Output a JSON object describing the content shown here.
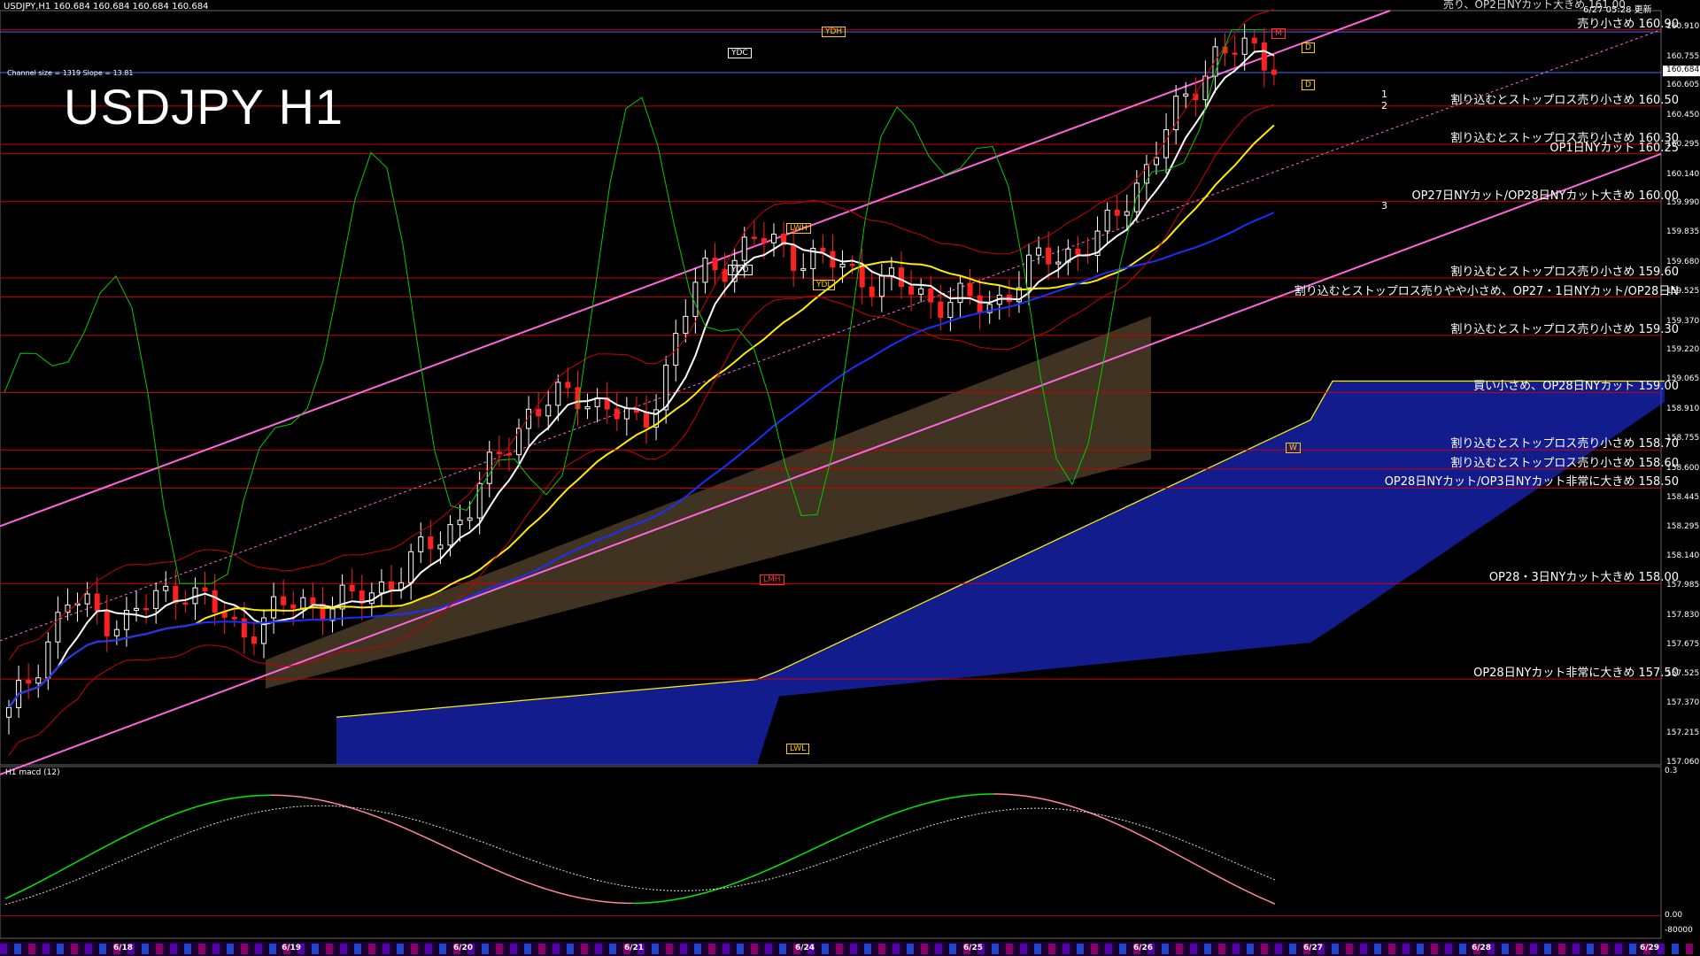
{
  "header": {
    "symbol_line": "USDJPY,H1  160.684 160.684 160.684 160.684",
    "channel_info": "Channel size = 1319 Slope = 13.81",
    "title": "USDJPY H1",
    "updated": "6/27 05:28 更新",
    "macd_label": "H1  macd (12)"
  },
  "colors": {
    "background": "#000000",
    "support_line": "#d00000",
    "bull_candle": "#ffffff",
    "bear_candle": "#ff2020",
    "channel": "#ff66dd",
    "ma_fast": "#ffffff",
    "ma_mid": "#ffee00",
    "ma_slow": "#1a2fff",
    "cloud_up": "#2233ff",
    "cloud_down": "#ffcc88",
    "macd_up": "#00ee00",
    "macd_down": "#ff8899",
    "adx": "#00cc00"
  },
  "chart_data": {
    "type": "candlestick",
    "symbol": "USDJPY",
    "timeframe": "H1",
    "ylim": [
      157.06,
      161.0
    ],
    "price_ticks": [
      "160.910",
      "160.755",
      "160.605",
      "160.450",
      "160.295",
      "160.140",
      "159.990",
      "159.835",
      "159.680",
      "159.525",
      "159.370",
      "159.220",
      "159.065",
      "158.910",
      "158.755",
      "158.600",
      "158.445",
      "158.295",
      "158.140",
      "157.985",
      "157.830",
      "157.675",
      "157.525",
      "157.370",
      "157.215",
      "157.060"
    ],
    "current_price": "160.684",
    "dates": [
      "6/18",
      "6/19",
      "6/20",
      "6/21",
      "6/24",
      "6/25",
      "6/26",
      "6/27",
      "6/28",
      "6/29"
    ],
    "price_path": [
      157.3,
      157.9,
      157.8,
      158.0,
      157.75,
      157.9,
      157.9,
      158.1,
      158.4,
      158.9,
      159.0,
      158.8,
      159.6,
      159.8,
      159.7,
      159.6,
      159.5,
      159.45,
      159.7,
      159.8,
      160.3,
      160.8,
      160.75
    ],
    "levels": [
      {
        "price": 160.9,
        "label": "売り小さめ 160.90"
      },
      {
        "price": 160.5,
        "label": "割り込むとストップロス売り小さめ 160.50"
      },
      {
        "price": 160.3,
        "label": "割り込むとストップロス売り小さめ 160.30"
      },
      {
        "price": 160.25,
        "label": "OP1日NYカット 160.25"
      },
      {
        "price": 160.0,
        "label": "OP27日NYカット/OP28日NYカット大きめ 160.00"
      },
      {
        "price": 159.6,
        "label": "割り込むとストップロス売り小さめ 159.60"
      },
      {
        "price": 159.5,
        "label": "割り込むとストップロス売りやや小さめ、OP27・1日NYカット/OP28日N"
      },
      {
        "price": 159.3,
        "label": "割り込むとストップロス売り小さめ 159.30"
      },
      {
        "price": 159.0,
        "label": "買い小さめ、OP28日NYカット 159.00"
      },
      {
        "price": 158.7,
        "label": "割り込むとストップロス売り小さめ 158.70"
      },
      {
        "price": 158.6,
        "label": "割り込むとストップロス売り小さめ 158.60"
      },
      {
        "price": 158.5,
        "label": "OP28日NYカット/OP3日NYカット非常に大きめ 158.50"
      },
      {
        "price": 158.0,
        "label": "OP28・3日NYカット大きめ 158.00"
      },
      {
        "price": 157.5,
        "label": "OP28日NYカット非常に大きめ 157.50"
      }
    ],
    "top_label": "売り、OP2日NYカット大きめ 161.00",
    "markers": [
      "YDH",
      "YDC",
      "YDO",
      "YDL",
      "LWH",
      "LWL",
      "LMH",
      "W",
      "D",
      "M"
    ],
    "line_labels": [
      "1",
      "2",
      "3"
    ],
    "macd_ticks": [
      "0.3",
      "0.00",
      "-80000"
    ]
  }
}
